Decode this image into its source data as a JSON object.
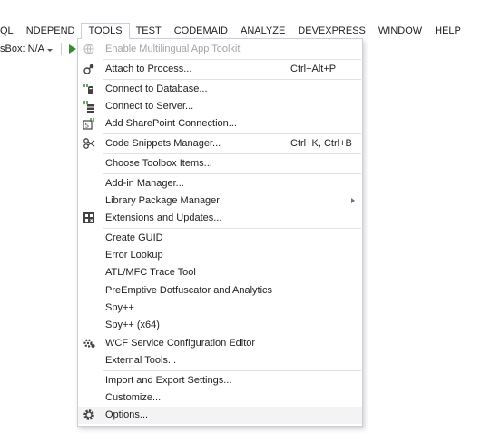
{
  "menubar": {
    "items": [
      "QL",
      "NDEPEND",
      "TOOLS",
      "TEST",
      "CODEMAID",
      "ANALYZE",
      "DEVEXPRESS",
      "WINDOW",
      "HELP"
    ],
    "active": "TOOLS"
  },
  "toolbar": {
    "label": "sBox: N/A"
  },
  "tools_menu": {
    "items": [
      {
        "label": "Enable Multilingual App Toolkit",
        "shortcut": "",
        "icon": "globe-icon",
        "disabled": true
      },
      {
        "label": "Attach to Process...",
        "shortcut": "Ctrl+Alt+P",
        "icon": "attach-process-icon"
      },
      {
        "label": "Connect to Database...",
        "shortcut": "",
        "icon": "connect-database-icon"
      },
      {
        "label": "Connect to Server...",
        "shortcut": "",
        "icon": "connect-server-icon"
      },
      {
        "label": "Add SharePoint Connection...",
        "shortcut": "",
        "icon": "sharepoint-icon"
      },
      {
        "label": "Code Snippets Manager...",
        "shortcut": "Ctrl+K, Ctrl+B",
        "icon": "code-snippets-icon"
      },
      {
        "label": "Choose Toolbox Items...",
        "shortcut": "",
        "icon": ""
      },
      {
        "label": "Add-in Manager...",
        "shortcut": "",
        "icon": ""
      },
      {
        "label": "Library Package Manager",
        "shortcut": "",
        "icon": "",
        "submenu": true
      },
      {
        "label": "Extensions and Updates...",
        "shortcut": "",
        "icon": "extensions-icon"
      },
      {
        "label": "Create GUID",
        "shortcut": "",
        "icon": ""
      },
      {
        "label": "Error Lookup",
        "shortcut": "",
        "icon": ""
      },
      {
        "label": "ATL/MFC Trace Tool",
        "shortcut": "",
        "icon": ""
      },
      {
        "label": "PreEmptive Dotfuscator and Analytics",
        "shortcut": "",
        "icon": ""
      },
      {
        "label": "Spy++",
        "shortcut": "",
        "icon": ""
      },
      {
        "label": "Spy++ (x64)",
        "shortcut": "",
        "icon": ""
      },
      {
        "label": "WCF Service Configuration Editor",
        "shortcut": "",
        "icon": "wcf-config-icon"
      },
      {
        "label": "External Tools...",
        "shortcut": "",
        "icon": ""
      },
      {
        "label": "Import and Export Settings...",
        "shortcut": "",
        "icon": ""
      },
      {
        "label": "Customize...",
        "shortcut": "",
        "icon": ""
      },
      {
        "label": "Options...",
        "shortcut": "",
        "icon": "gear-icon",
        "highlighted": true
      }
    ]
  }
}
